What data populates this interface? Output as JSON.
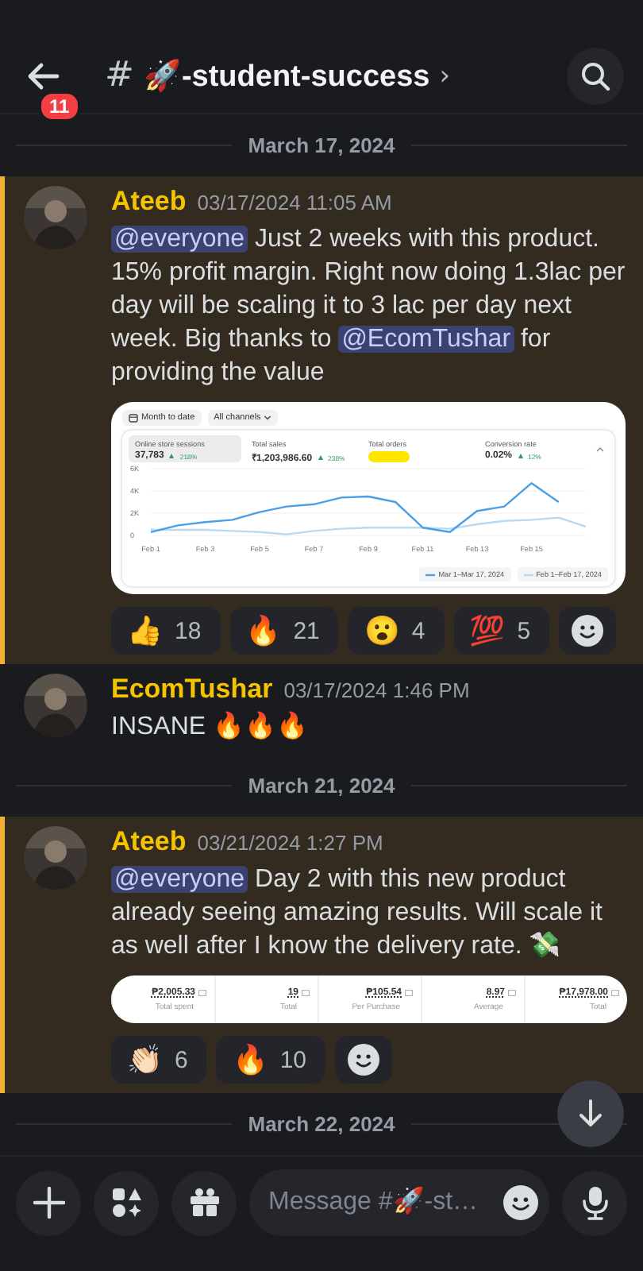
{
  "header": {
    "unread_badge": "11",
    "channel_prefix": "#",
    "channel_name": "🚀-student-success",
    "chevron": "›"
  },
  "feed": [
    {
      "kind": "divider",
      "date": "March 17, 2024"
    },
    {
      "kind": "message",
      "highlighted": true,
      "author": "Ateeb",
      "timestamp": "03/17/2024 11:05 AM",
      "content": [
        {
          "mention": "@everyone"
        },
        {
          "text": " Just 2 weeks with this product. 15% profit margin. Right now doing 1.3lac per day will be scaling it to 3 lac per day next week. Big thanks to "
        },
        {
          "mention": "@EcomTushar"
        },
        {
          "text": " for providing the value"
        }
      ],
      "attachment": {
        "kind": "dashboard",
        "date_filter": "Month to date",
        "channel_filter": "All channels",
        "metrics": [
          {
            "label": "Online store sessions",
            "value": "37,783",
            "change": "218%",
            "redacted": false,
            "selected": true
          },
          {
            "label": "Total sales",
            "value": "₹1,203,986.60",
            "change": "238%",
            "redacted": false,
            "selected": false
          },
          {
            "label": "Total orders",
            "redacted": true,
            "selected": false
          },
          {
            "label": "Conversion rate",
            "value": "0.02%",
            "change": "12%",
            "redacted": false,
            "selected": false
          }
        ],
        "chart_data": {
          "type": "line",
          "categories": [
            "Feb 1",
            null,
            "Feb 3",
            null,
            "Feb 5",
            null,
            "Feb 7",
            null,
            "Feb 9",
            null,
            "Feb 11",
            null,
            "Feb 13",
            null,
            "Feb 15",
            null,
            null
          ],
          "yticks": [
            {
              "value": 0,
              "label": "0"
            },
            {
              "value": 2000,
              "label": "2K"
            },
            {
              "value": 4000,
              "label": "4K"
            },
            {
              "value": 6000,
              "label": "6K"
            }
          ],
          "ylim": [
            0,
            6000
          ],
          "series": [
            {
              "name": "Mar 1–Mar 17, 2024",
              "color": "#4a9fe6",
              "values": [
                300,
                900,
                1200,
                1400,
                2100,
                2600,
                2800,
                3400,
                3500,
                3000,
                700,
                300,
                2200,
                2600,
                4700,
                3000,
                null
              ]
            },
            {
              "name": "Feb 1–Feb 17, 2024",
              "color": "#b8daf4",
              "values": [
                500,
                500,
                500,
                400,
                300,
                100,
                400,
                600,
                700,
                700,
                700,
                600,
                1000,
                1300,
                1400,
                1600,
                800
              ]
            }
          ]
        }
      },
      "reactions": [
        {
          "emoji": "👍",
          "count": "18"
        },
        {
          "emoji": "🔥",
          "count": "21"
        },
        {
          "emoji": "😮",
          "count": "4"
        },
        {
          "emoji": "💯",
          "count": "5"
        }
      ]
    },
    {
      "kind": "message",
      "highlighted": false,
      "author": "EcomTushar",
      "timestamp": "03/17/2024 1:46 PM",
      "content": [
        {
          "text": "INSANE 🔥🔥🔥"
        }
      ]
    },
    {
      "kind": "divider",
      "date": "March 21, 2024"
    },
    {
      "kind": "message",
      "highlighted": true,
      "author": "Ateeb",
      "timestamp": "03/21/2024 1:27 PM",
      "content": [
        {
          "mention": "@everyone"
        },
        {
          "text": " Day 2 with this new product already seeing amazing results. Will scale it as well after I know the delivery rate. 💸"
        }
      ],
      "attachment": {
        "kind": "stats_table",
        "cells": [
          {
            "value": "₱2,005.33",
            "label": "Total spent"
          },
          {
            "value": "19",
            "label": "Total"
          },
          {
            "value": "₱105.54",
            "label": "Per Purchase"
          },
          {
            "value": "8.97",
            "label": "Average"
          },
          {
            "value": "₱17,978.00",
            "label": "Total"
          }
        ]
      },
      "reactions": [
        {
          "emoji": "👏🏻",
          "count": "6"
        },
        {
          "emoji": "🔥",
          "count": "10"
        }
      ]
    },
    {
      "kind": "divider",
      "date": "March 22, 2024"
    }
  ],
  "composer": {
    "placeholder": "Message #🚀-st…"
  }
}
